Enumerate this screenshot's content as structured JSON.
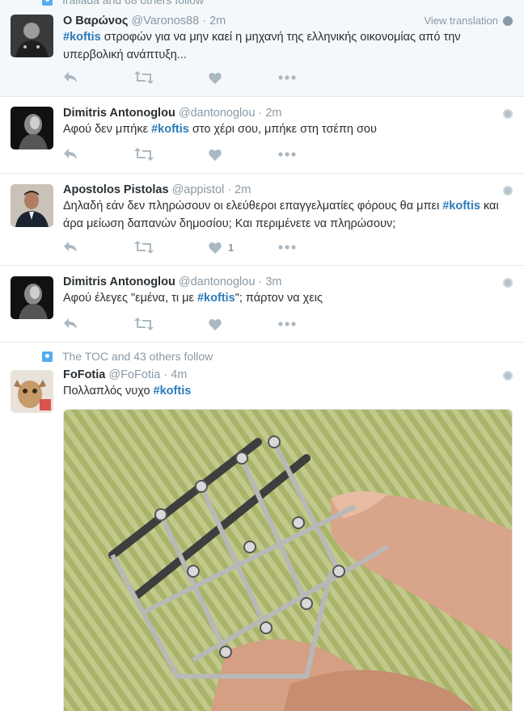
{
  "tweets": [
    {
      "context": "Iraliada and 68 others follow",
      "name": "Ο Βαρώνος",
      "handle": "@Varonos88",
      "time": "2m",
      "view_translation": "View translation",
      "text_before": "",
      "hashtag": "#koftis",
      "text_after": " στροφών για να μην καεί η μηχανή της ελληνικής οικονομίας από την υπερβολική ανάπτυξη...",
      "likes": ""
    },
    {
      "name": "Dimitris Antonoglou",
      "handle": "@dantonoglou",
      "time": "2m",
      "text_before": "Αφού δεν μπήκε ",
      "hashtag": "#koftis",
      "text_after": " στο χέρι σου, μπήκε στη τσέπη σου",
      "likes": ""
    },
    {
      "name": "Apostolos Pistolas",
      "handle": "@appistol",
      "time": "2m",
      "text_before": "Δηλαδή εάν δεν πληρώσουν οι ελεύθεροι επαγγελματίες φόρους θα μπει ",
      "hashtag": "#koftis",
      "text_after": " και άρα μείωση δαπανών δημοσίου; Και περιμένετε να πληρώσουν;",
      "likes": "1"
    },
    {
      "name": "Dimitris Antonoglou",
      "handle": "@dantonoglou",
      "time": "3m",
      "text_before": "Αφού έλεγες \"εμένα, τι με ",
      "hashtag": "#koftis",
      "text_after": "\"; πάρτον να χεις",
      "likes": ""
    },
    {
      "context": "The TOC and 43 others follow",
      "name": "FoFotia",
      "handle": "@FoFotia",
      "time": "4m",
      "text_before": "Πολλαπλός νυχο ",
      "hashtag": "#koftis",
      "text_after": "",
      "likes": ""
    }
  ],
  "separator": "·",
  "colors": {
    "hashtag": "#2b7bb9",
    "muted": "#8899a6",
    "highlight_bg": "#f5f8fa"
  },
  "icons": [
    "reply-icon",
    "retweet-icon",
    "like-icon",
    "more-icon",
    "globe-icon",
    "follow-badge-icon"
  ]
}
